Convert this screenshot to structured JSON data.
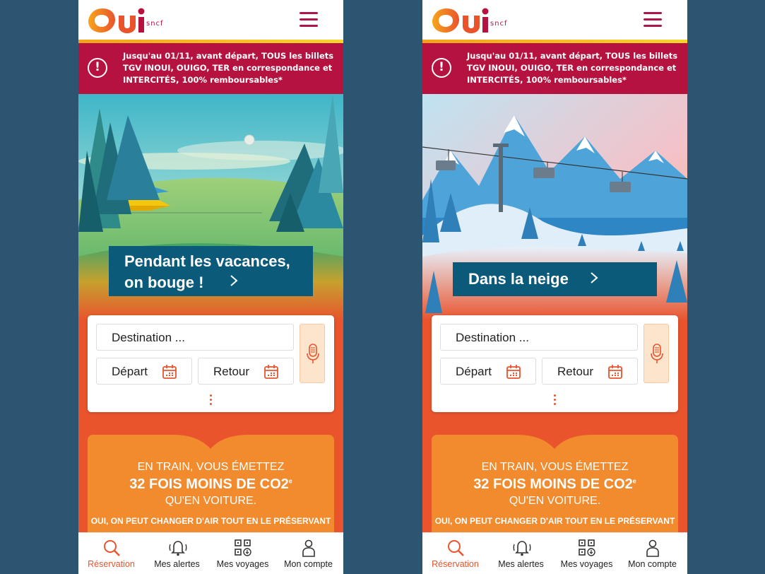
{
  "brand": {
    "logo_sub": "sncf",
    "colors": {
      "primary": "#b5123f",
      "accent": "#e9542d",
      "banner": "#0b5a7a",
      "background": "#2b5570"
    }
  },
  "alert": {
    "icon": "alert-icon",
    "text": "Jusqu'au 01/11, avant départ, TOUS les billets TGV INOUI, OUIGO, TER en correspondance et INTERCITÉS, 100% remboursables*"
  },
  "screens": [
    {
      "banner": "Pendant les vacances, on bouge !",
      "illustration": "train-landscape"
    },
    {
      "banner": "Dans la neige",
      "illustration": "ski-lift-snow"
    }
  ],
  "search": {
    "destination_placeholder": "Destination ...",
    "depart_label": "Départ",
    "retour_label": "Retour"
  },
  "co2": {
    "line1": "EN TRAIN, VOUS ÉMETTEZ",
    "line2": "32 FOIS MOINS DE CO2",
    "line2_sup": "e",
    "line3": "QU'EN VOITURE.",
    "line4": "OUI, ON PEUT CHANGER D'AIR TOUT EN LE PRÉSERVANT"
  },
  "tabbar": {
    "reservation": "Réservation",
    "alertes": "Mes alertes",
    "voyages": "Mes voyages",
    "compte": "Mon compte"
  }
}
